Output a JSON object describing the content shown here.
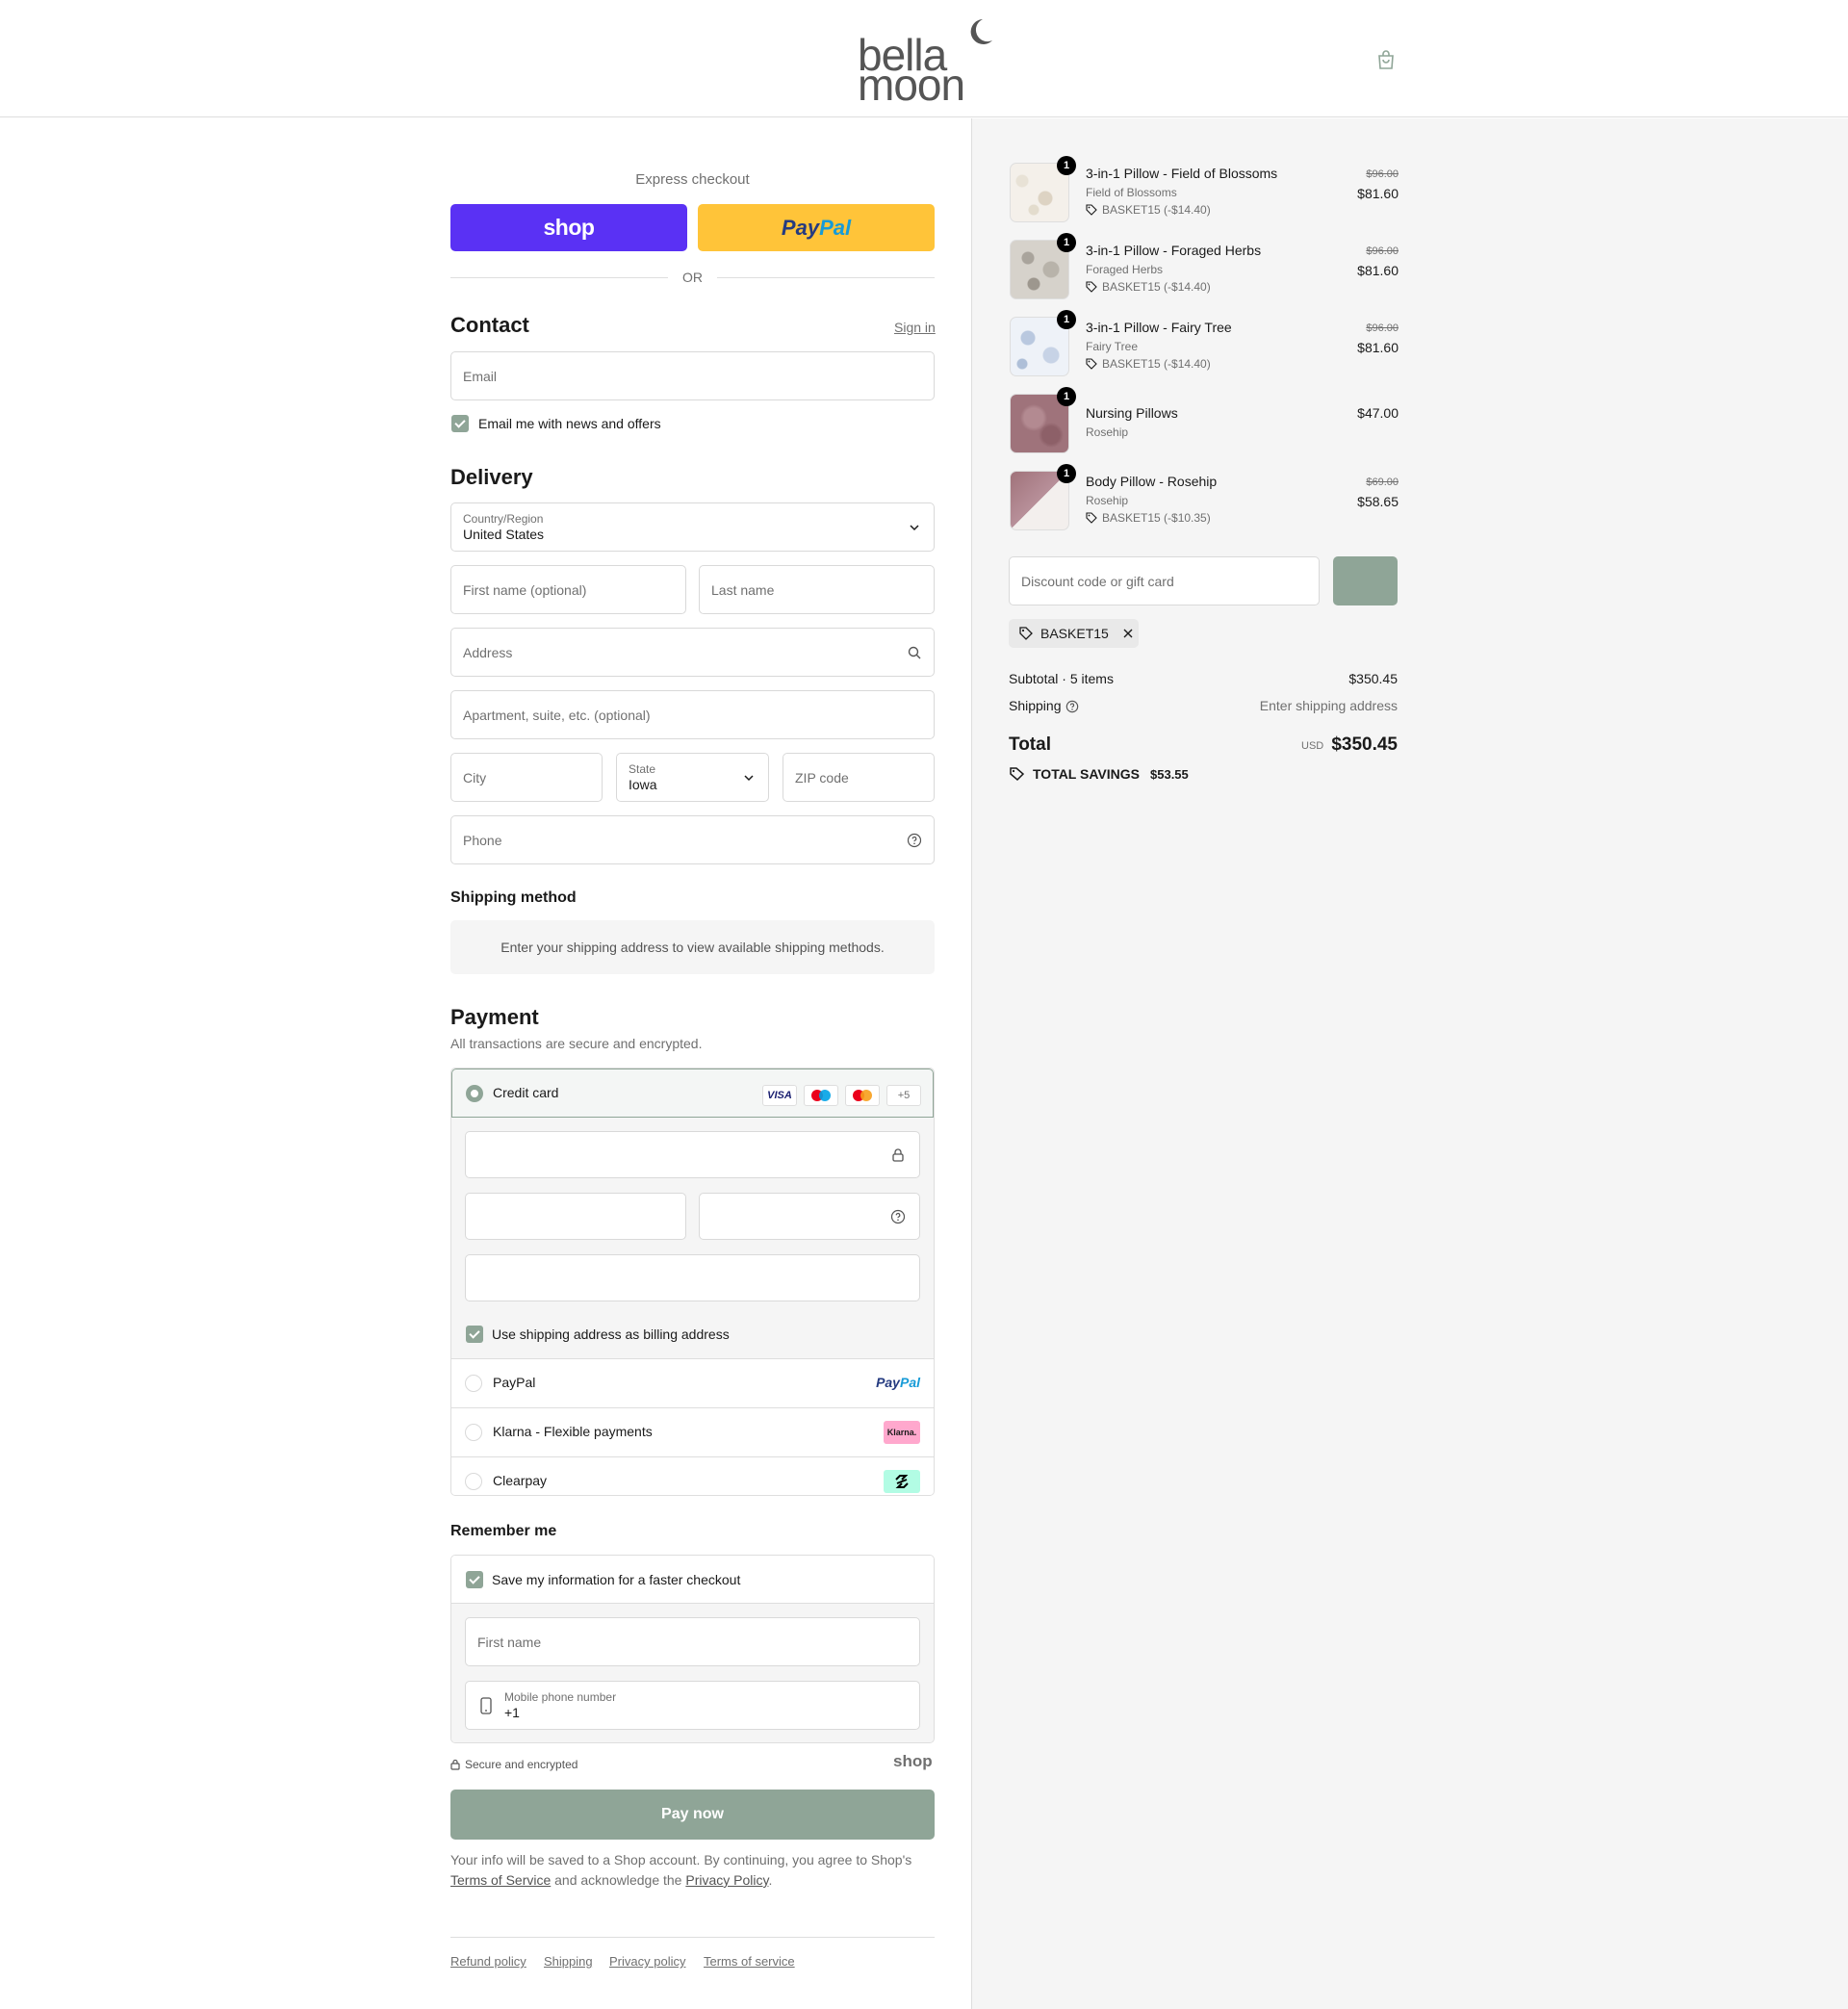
{
  "brand": {
    "line1": "bella",
    "line2": "moon"
  },
  "express": {
    "label": "Express checkout",
    "shop_label": "shop",
    "paypal_a": "Pay",
    "paypal_b": "Pal",
    "or": "OR"
  },
  "contact": {
    "title": "Contact",
    "signin": "Sign in",
    "email_placeholder": "Email",
    "newsletter": "Email me with news and offers"
  },
  "delivery": {
    "title": "Delivery",
    "country_label": "Country/Region",
    "country_value": "United States",
    "first_name": "First name (optional)",
    "last_name": "Last name",
    "address": "Address",
    "apartment": "Apartment, suite, etc. (optional)",
    "city": "City",
    "state_label": "State",
    "state_value": "Iowa",
    "zip": "ZIP code",
    "phone": "Phone"
  },
  "shipping_method": {
    "title": "Shipping method",
    "info": "Enter your shipping address to view available shipping methods."
  },
  "payment": {
    "title": "Payment",
    "subtitle": "All transactions are secure and encrypted.",
    "credit_card": "Credit card",
    "cards": [
      "VISA",
      "",
      "",
      "+5"
    ],
    "billing_same": "Use shipping address as billing address",
    "paypal": "PayPal",
    "paypal_logo_a": "Pay",
    "paypal_logo_b": "Pal",
    "klarna": "Klarna - Flexible payments",
    "klarna_logo": "Klarna.",
    "clearpay": "Clearpay"
  },
  "remember": {
    "title": "Remember me",
    "save": "Save my information for a faster checkout",
    "first_name": "First name",
    "mobile_label": "Mobile phone number",
    "mobile_value": "+1",
    "secure": "Secure and encrypted",
    "shop_logo": "shop"
  },
  "pay_now": "Pay now",
  "legal": {
    "text1": "Your info will be saved to a Shop account. By continuing, you agree to Shop's",
    "tos": "Terms of Service",
    "text2": "and acknowledge the",
    "privacy": "Privacy Policy",
    "end": "."
  },
  "footer": [
    "Refund policy",
    "Shipping",
    "Privacy policy",
    "Terms of service"
  ],
  "items": [
    {
      "qty": "1",
      "name": "3-in-1 Pillow - Field of Blossoms",
      "variant": "Field of Blossoms",
      "discount": "BASKET15 (-$14.40)",
      "old_price": "$96.00",
      "price": "$81.60"
    },
    {
      "qty": "1",
      "name": "3-in-1 Pillow - Foraged Herbs",
      "variant": "Foraged Herbs",
      "discount": "BASKET15 (-$14.40)",
      "old_price": "$96.00",
      "price": "$81.60"
    },
    {
      "qty": "1",
      "name": "3-in-1 Pillow - Fairy Tree",
      "variant": "Fairy Tree",
      "discount": "BASKET15 (-$14.40)",
      "old_price": "$96.00",
      "price": "$81.60"
    },
    {
      "qty": "1",
      "name": "Nursing Pillows",
      "variant": "Rosehip",
      "price": "$47.00"
    },
    {
      "qty": "1",
      "name": "Body Pillow - Rosehip",
      "variant": "Rosehip",
      "discount": "BASKET15 (-$10.35)",
      "old_price": "$69.00",
      "price": "$58.65"
    }
  ],
  "summary": {
    "discount_placeholder": "Discount code or gift card",
    "applied_code": "BASKET15",
    "subtotal_label": "Subtotal · 5 items",
    "subtotal": "$350.45",
    "shipping_label": "Shipping",
    "shipping_value": "Enter shipping address",
    "total_label": "Total",
    "currency": "USD",
    "total": "$350.45",
    "savings_label": "TOTAL SAVINGS",
    "savings": "$53.55"
  },
  "colors": {
    "accent": "#8fa597",
    "shop": "#5a31f4",
    "paypal": "#ffc439"
  }
}
